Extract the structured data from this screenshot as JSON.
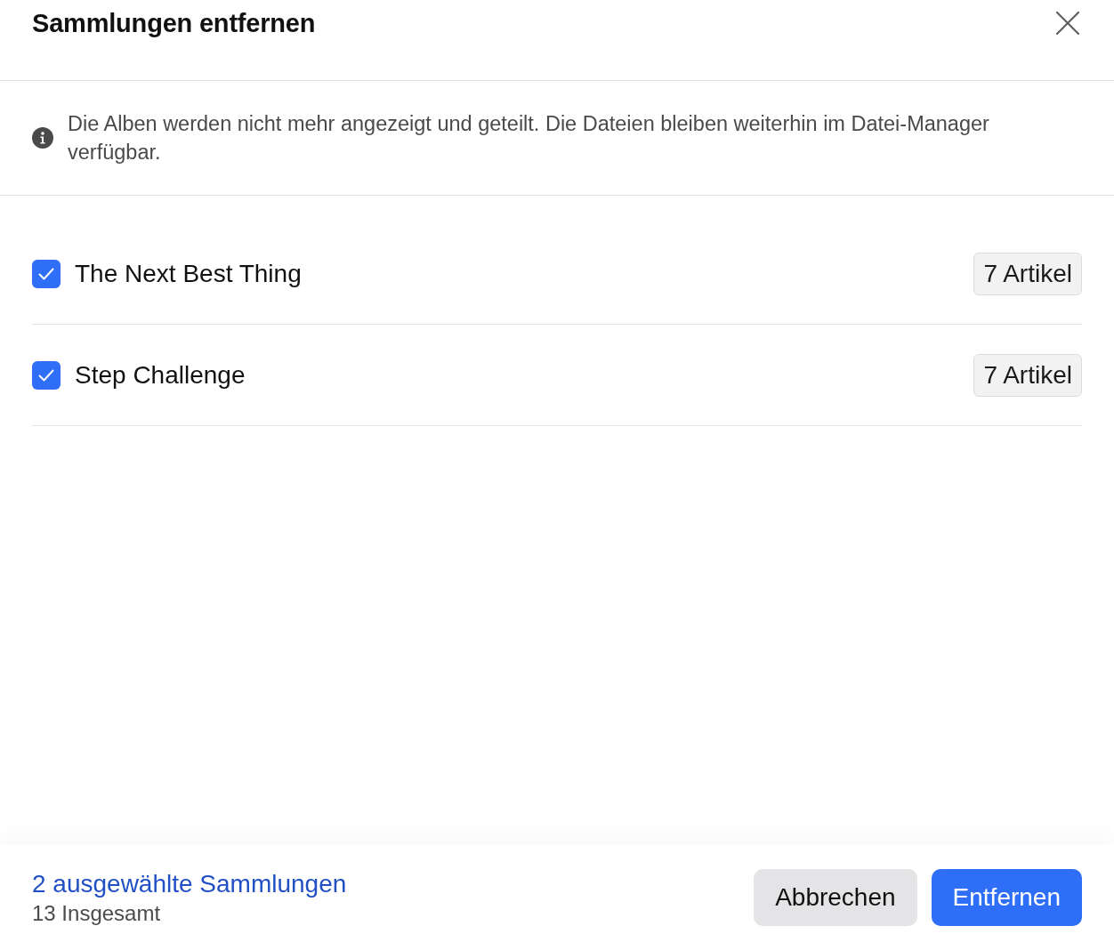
{
  "dialog": {
    "title": "Sammlungen entfernen"
  },
  "notice": {
    "text": "Die Alben werden nicht mehr angezeigt und geteilt. Die Dateien bleiben weiterhin im Datei-Manager verfügbar."
  },
  "collections": [
    {
      "name": "The Next Best Thing",
      "checked": true,
      "count": "7 Artikel"
    },
    {
      "name": "Step Challenge",
      "checked": true,
      "count": "7 Artikel"
    }
  ],
  "footer": {
    "selection": "2 ausgewählte Sammlungen",
    "total": "13 Insgesamt",
    "buttons": [
      {
        "label": "Abbrechen",
        "kind": "secondary"
      },
      {
        "label": "Entfernen",
        "kind": "primary"
      }
    ]
  }
}
